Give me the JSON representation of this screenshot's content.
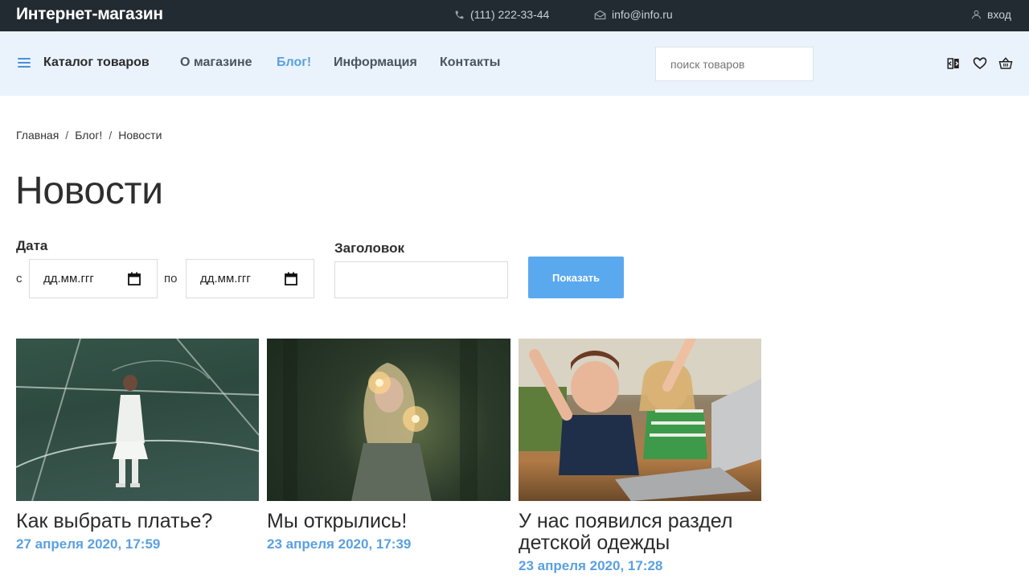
{
  "topbar": {
    "logo": "Интернет-магазин",
    "phone": "(111) 222-33-44",
    "email": "info@info.ru",
    "login": "вход"
  },
  "nav": {
    "catalog": "Каталог товаров",
    "links": [
      "О магазине",
      "Блог!",
      "Информация",
      "Контакты"
    ],
    "active_link": "Блог!",
    "search_placeholder": "поиск товаров",
    "icons": [
      "compare-icon",
      "heart-icon",
      "basket-icon"
    ]
  },
  "breadcrumb": [
    "Главная",
    "Блог!",
    "Новости"
  ],
  "page_title": "Новости",
  "filter": {
    "date_label": "Дата",
    "from_label": "с",
    "to_label": "по",
    "date_from": "дд.мм.ггг",
    "date_to": "дд.мм.ггг",
    "heading_label": "Заголовок",
    "heading_value": "",
    "button": "Показать"
  },
  "posts": [
    {
      "title": "Как выбрать платье?",
      "date": "27 апреля 2020, 17:59"
    },
    {
      "title": "Мы открылись!",
      "date": "23 апреля 2020, 17:39"
    },
    {
      "title": "У нас появился раздел детской одежды",
      "date": "23 апреля 2020, 17:28"
    }
  ],
  "colors": {
    "topbar": "#222b32",
    "navbar": "#eaf3fb",
    "accent": "#5aa0e0",
    "button": "#5aa9ef"
  }
}
